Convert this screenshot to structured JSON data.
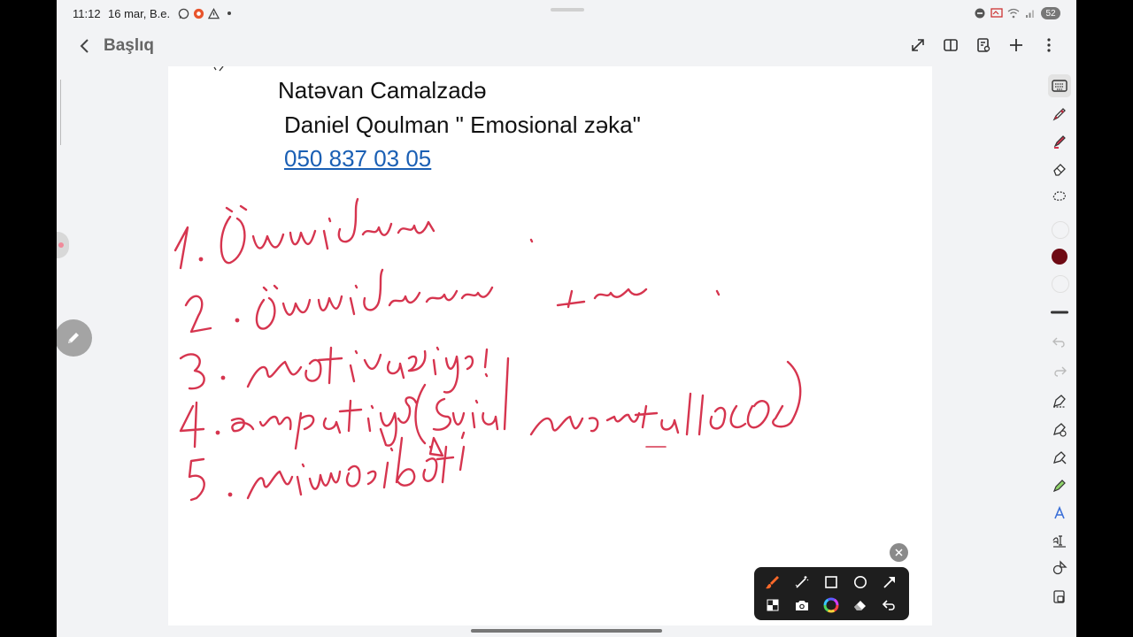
{
  "status_bar": {
    "time": "11:12",
    "date": "16 mar, B.e.",
    "left_icons": [
      "whatsapp-icon",
      "app-notification-icon",
      "warning-icon"
    ],
    "right_icons": [
      "dnd-icon",
      "cast-icon",
      "wifi-icon",
      "signal-icon"
    ],
    "battery": "52"
  },
  "header": {
    "title": "Başlıq",
    "actions": [
      "expand-icon",
      "book-view-icon",
      "page-settings-icon",
      "add-icon",
      "more-icon"
    ]
  },
  "note": {
    "line1": "Natəvan Camalzadə",
    "line2": "Daniel Qoulman \" Emosional zəka\"",
    "phone": "050 837 03 05"
  },
  "handwriting": {
    "color": "#d6354f",
    "items_count": 5
  },
  "right_toolbar": {
    "tools": [
      "keyboard-icon",
      "pen-icon",
      "highlighter-icon",
      "eraser-icon",
      "lasso-icon"
    ],
    "colors": [
      "#f3f3f3",
      "#6e0a14",
      "#f3f3f3"
    ],
    "more_tools": [
      "stroke-width-icon",
      "undo-icon",
      "redo-icon",
      "shape-pen-icon",
      "shape-recognize-icon",
      "shape-fill-icon",
      "marker-icon",
      "text-style-icon",
      "text-tool-icon",
      "shapes-icon",
      "lock-icon"
    ]
  },
  "floating_toolbar": {
    "row1": [
      "brush-icon",
      "magic-pen-icon",
      "rectangle-icon",
      "circle-icon",
      "arrow-icon"
    ],
    "row2": [
      "pattern-icon",
      "camera-icon",
      "color-wheel-icon",
      "eraser-icon",
      "undo-icon"
    ],
    "accent": "#ff6a2a"
  },
  "colors": {
    "ink": "#d6354f",
    "link": "#1a5fb4",
    "background": "#f2f3f5"
  }
}
